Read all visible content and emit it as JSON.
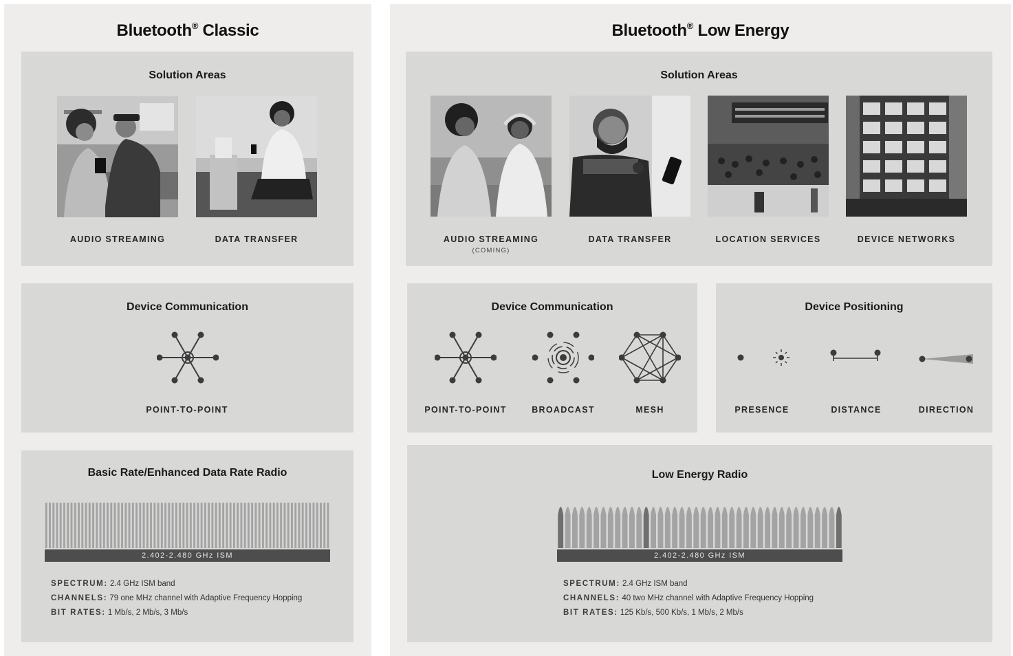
{
  "classic": {
    "title": "Bluetooth",
    "title_suffix": "Classic",
    "reg": "®",
    "solution": {
      "title": "Solution Areas",
      "items": [
        {
          "label": "AUDIO STREAMING",
          "icon": "audio-streaming-photo"
        },
        {
          "label": "DATA TRANSFER",
          "icon": "data-transfer-photo"
        }
      ]
    },
    "device_communication": {
      "title": "Device Communication",
      "items": [
        {
          "label": "POINT-TO-POINT",
          "icon": "point-to-point-icon"
        }
      ]
    },
    "radio": {
      "title": "Basic Rate/Enhanced Data Rate Radio",
      "band": "2.402-2.480 GHz ISM",
      "channel_count": 79,
      "specs": [
        {
          "key": "SPECTRUM:",
          "value": "2.4 GHz ISM band"
        },
        {
          "key": "CHANNELS:",
          "value": "79 one MHz channel with Adaptive Frequency Hopping"
        },
        {
          "key": "BIT RATES:",
          "value": "1 Mb/s, 2 Mb/s, 3 Mb/s"
        }
      ]
    }
  },
  "le": {
    "title": "Bluetooth",
    "title_suffix": "Low Energy",
    "reg": "®",
    "solution": {
      "title": "Solution Areas",
      "items": [
        {
          "label": "AUDIO STREAMING",
          "sub": "(COMING)",
          "icon": "audio-streaming-photo"
        },
        {
          "label": "DATA TRANSFER",
          "icon": "data-transfer-photo"
        },
        {
          "label": "LOCATION SERVICES",
          "icon": "location-services-photo"
        },
        {
          "label": "DEVICE NETWORKS",
          "icon": "device-networks-photo"
        }
      ]
    },
    "device_communication": {
      "title": "Device Communication",
      "items": [
        {
          "label": "POINT-TO-POINT",
          "icon": "point-to-point-icon"
        },
        {
          "label": "BROADCAST",
          "icon": "broadcast-icon"
        },
        {
          "label": "MESH",
          "icon": "mesh-icon"
        }
      ]
    },
    "device_positioning": {
      "title": "Device Positioning",
      "items": [
        {
          "label": "PRESENCE",
          "icon": "presence-icon"
        },
        {
          "label": "DISTANCE",
          "icon": "distance-icon"
        },
        {
          "label": "DIRECTION",
          "icon": "direction-icon"
        }
      ]
    },
    "radio": {
      "title": "Low Energy Radio",
      "band": "2.402-2.480 GHz ISM",
      "channel_count": 40,
      "specs": [
        {
          "key": "SPECTRUM:",
          "value": "2.4 GHz ISM band"
        },
        {
          "key": "CHANNELS:",
          "value": "40 two MHz channel with Adaptive Frequency Hopping"
        },
        {
          "key": "BIT RATES:",
          "value": "125 Kb/s, 500 Kb/s, 1 Mb/s, 2 Mb/s"
        }
      ]
    }
  },
  "colors": {
    "column_bg": "#efedeb",
    "panel_bg": "#d8d8d7",
    "band_bg": "#4d4d4d",
    "channel": "#a3a3a3",
    "channel_dark": "#6f6f6f",
    "icon": "#3c3c3c"
  }
}
